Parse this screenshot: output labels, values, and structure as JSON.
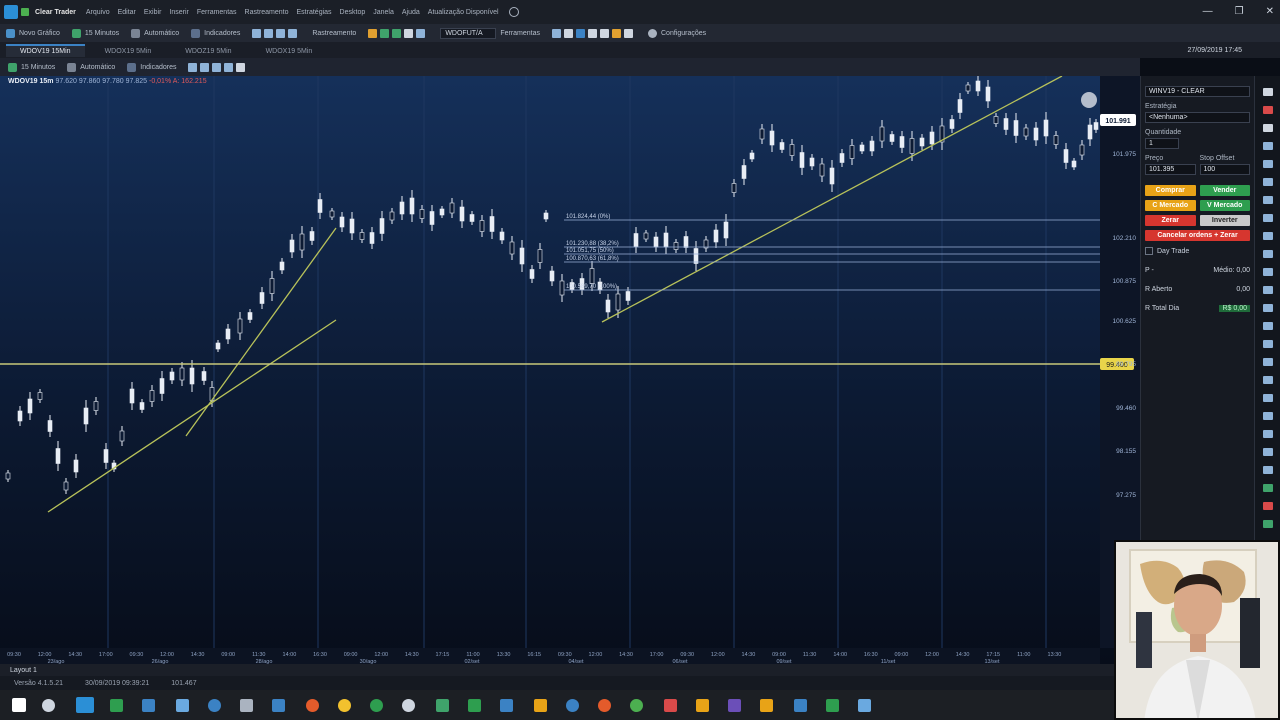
{
  "titlebar": {
    "app_name": "Clear Trader",
    "menus": [
      "Arquivo",
      "Editar",
      "Exibir",
      "Inserir",
      "Ferramentas",
      "Rastreamento",
      "Estratégias",
      "Desktop",
      "Janela",
      "Ajuda",
      "Atualização Disponível"
    ],
    "window_buttons": [
      "—",
      "❐",
      "✕"
    ]
  },
  "toolbar": {
    "new_chart": "Novo Gráfico",
    "timeframe": "15 Minutos",
    "scale": "Automático",
    "indicators": "Indicadores",
    "drawing": "Rastreamento",
    "symbol_select": "WDOFUT/A",
    "tools": "Ferramentas",
    "settings": "Configurações"
  },
  "tabs": [
    "WDOV19 15Min",
    "WDOX19 5Min",
    "WDOZ19 5Min",
    "WDOX19 5Min"
  ],
  "clock": "27/09/2019 17:45",
  "chart_toolbar": {
    "timeframe": "15 Minutos",
    "scale": "Automático",
    "indicators": "Indicadores"
  },
  "quote": {
    "symbol": "WDOV19 15m",
    "open": "97.620",
    "high": "97.860",
    "low": "97.780",
    "close": "97.825",
    "change_pct": "-0,01%",
    "volume": "A: 162.215"
  },
  "chart_data": {
    "type": "candlestick",
    "price_labels": [
      "101.975",
      "102.210",
      "100.875",
      "100.625",
      "99.795",
      "99.460",
      "98.155",
      "97.275",
      "96.430"
    ],
    "current_price": "101.991",
    "hline_price": "99.400",
    "time_labels": [
      "09:30",
      "12:00",
      "14:30",
      "17:00",
      "09:30",
      "12:00",
      "14:30",
      "09:00",
      "11:30",
      "14:00",
      "16:30",
      "09:00",
      "12:00",
      "14:30",
      "17:15",
      "11:00",
      "13:30",
      "16:15",
      "09:30",
      "12:00",
      "14:30",
      "17:00",
      "09:30",
      "12:00",
      "14:30",
      "09:00",
      "11:30",
      "14:00",
      "16:30",
      "09:00",
      "12:00",
      "14:30",
      "17:15",
      "11:00",
      "13:30"
    ],
    "date_labels": [
      "23/ago",
      "26/ago",
      "28/ago",
      "30/ago",
      "02/set",
      "04/set",
      "06/set",
      "09/set",
      "11/set",
      "13/set",
      "16/set",
      "18/set",
      "20/set",
      "23/set",
      "25/set",
      "27/set"
    ],
    "fib_labels": [
      "101.824,44 (0%)",
      "101.230,88 (38,2%)",
      "101.051,75 (50%)",
      "100.870,63 (61,8%)",
      "100.589,70 (100%)"
    ]
  },
  "bottombar": {
    "layout": "Layout 1"
  },
  "statusbar": [
    "Versão 4.1.5.21",
    "30/09/2019 09:39:21",
    "101.467"
  ],
  "rightpanel": {
    "account": "WINV19 - CLEAR",
    "strategy_label": "Estratégia",
    "strategy_value": "<Nenhuma>",
    "qty_label": "Quantidade",
    "qty_value": "1",
    "price_label": "Preço",
    "price_value": "101.395",
    "stop_label": "Stop Offset",
    "stop_value": "100",
    "buy": "Comprar",
    "sell": "Vender",
    "buy_market": "C Mercado",
    "sell_market": "V Mercado",
    "zero": "Zerar",
    "invert": "Inverter",
    "cancel_all": "Cancelar ordens + Zerar",
    "day_trade": "Day Trade",
    "pos_label": "P -",
    "avg_label": "Médio: 0,00",
    "open_label": "R Aberto",
    "open_value": "0,00",
    "day_total_label": "R Total Dia",
    "day_total_value": "R$ 0,00"
  },
  "colors": {
    "buy": "#e8a317",
    "sell": "#2e9e4f",
    "zero": "#d6362f",
    "invert": "#c9c9c9",
    "trendline": "#b8c25a",
    "hline": "#c8c87a"
  }
}
